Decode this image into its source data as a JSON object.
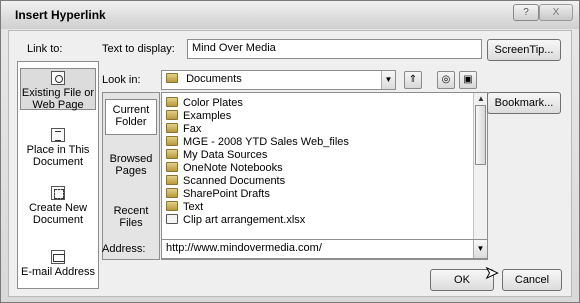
{
  "window": {
    "title": "Insert Hyperlink",
    "help_icon": "?",
    "close_icon": "X"
  },
  "link_to": {
    "label": "Link to:",
    "items": [
      {
        "label": "Existing File or Web Page",
        "icon": "globe-icon"
      },
      {
        "label": "Place in This Document",
        "icon": "document-icon"
      },
      {
        "label": "Create New Document",
        "icon": "new-document-icon"
      },
      {
        "label": "E-mail Address",
        "icon": "mail-icon"
      }
    ]
  },
  "text_to_display": {
    "label": "Text to display:",
    "value": "Mind Over Media"
  },
  "screentip_label": "ScreenTip...",
  "look_in": {
    "label": "Look in:",
    "value": "Documents"
  },
  "nav": {
    "items": [
      "Current Folder",
      "Browsed Pages",
      "Recent Files"
    ]
  },
  "files": [
    {
      "name": "Color Plates",
      "type": "folder"
    },
    {
      "name": "Examples",
      "type": "folder"
    },
    {
      "name": "Fax",
      "type": "folder"
    },
    {
      "name": "MGE - 2008 YTD Sales Web_files",
      "type": "folder"
    },
    {
      "name": "My Data Sources",
      "type": "folder"
    },
    {
      "name": "OneNote Notebooks",
      "type": "folder"
    },
    {
      "name": "Scanned Documents",
      "type": "folder"
    },
    {
      "name": "SharePoint Drafts",
      "type": "folder"
    },
    {
      "name": "Text",
      "type": "folder"
    },
    {
      "name": "Clip art arrangement.xlsx",
      "type": "file"
    }
  ],
  "bookmark_label": "Bookmark...",
  "address": {
    "label": "Address:",
    "value": "http://www.mindovermedia.com/"
  },
  "ok_label": "OK",
  "cancel_label": "Cancel"
}
